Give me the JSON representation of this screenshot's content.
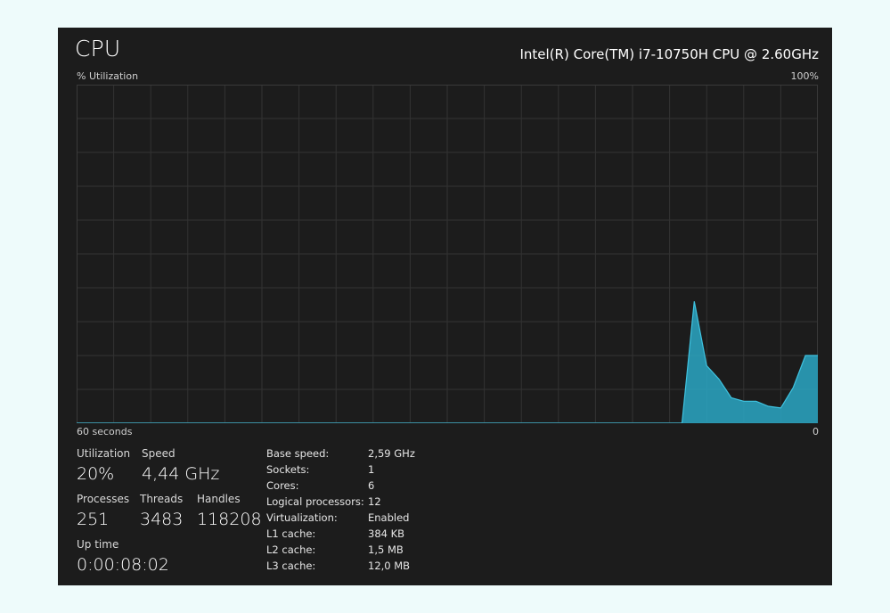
{
  "header": {
    "title": "CPU",
    "cpu_name": "Intel(R) Core(TM) i7-10750H CPU @ 2.60GHz"
  },
  "graph": {
    "y_label": "% Utilization",
    "y_max_label": "100%",
    "x_label": "60 seconds",
    "x_end_label": "0",
    "colors": {
      "fill": "#2aa7c4",
      "line": "#3fc3e0",
      "grid": "#333333",
      "border": "#3a3a3a"
    }
  },
  "chart_data": {
    "type": "area",
    "x_label": "60 seconds",
    "y_label": "% Utilization",
    "ylim": [
      0,
      100
    ],
    "xlim": [
      60,
      0
    ],
    "grid": true,
    "x_seconds_ago": [
      60,
      11,
      10,
      9,
      8,
      7,
      6,
      5,
      4,
      3,
      2,
      1,
      0
    ],
    "values": [
      0,
      0,
      36,
      17,
      13,
      7.5,
      6.5,
      6.5,
      5,
      4.5,
      10.5,
      20,
      20
    ]
  },
  "stats": {
    "utilization": {
      "label": "Utilization",
      "value": "20%"
    },
    "speed": {
      "label": "Speed",
      "value": "4,44 GHz"
    },
    "processes": {
      "label": "Processes",
      "value": "251"
    },
    "threads": {
      "label": "Threads",
      "value": "3483"
    },
    "handles": {
      "label": "Handles",
      "value": "118208"
    },
    "uptime": {
      "label": "Up time",
      "value": "0:00:08:02"
    }
  },
  "info": [
    {
      "key": "Base speed:",
      "value": "2,59 GHz"
    },
    {
      "key": "Sockets:",
      "value": "1"
    },
    {
      "key": "Cores:",
      "value": "6"
    },
    {
      "key": "Logical processors:",
      "value": "12"
    },
    {
      "key": "Virtualization:",
      "value": "Enabled"
    },
    {
      "key": "L1 cache:",
      "value": "384 KB"
    },
    {
      "key": "L2 cache:",
      "value": "1,5 MB"
    },
    {
      "key": "L3 cache:",
      "value": "12,0 MB"
    }
  ]
}
